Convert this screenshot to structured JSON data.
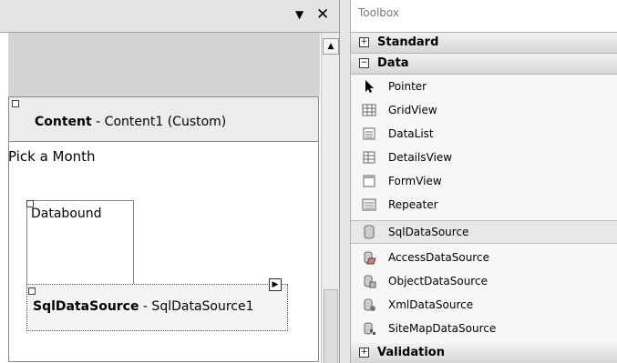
{
  "designer": {
    "content_title_bold": "Content",
    "content_title_rest": " - Content1 (Custom)",
    "pick_month_text": "Pick a Month",
    "databound_label": "Databound",
    "sql_title_bold": "SqlDataSource",
    "sql_title_rest": " - SqlDataSource1"
  },
  "toolbox": {
    "title": "Toolbox",
    "groups": {
      "standard": "Standard",
      "data": "Data",
      "validation": "Validation"
    },
    "tools": [
      {
        "label": "Pointer",
        "icon": "pointer-icon"
      },
      {
        "label": "GridView",
        "icon": "gridview-icon"
      },
      {
        "label": "DataList",
        "icon": "datalist-icon"
      },
      {
        "label": "DetailsView",
        "icon": "detailsview-icon"
      },
      {
        "label": "FormView",
        "icon": "formview-icon"
      },
      {
        "label": "Repeater",
        "icon": "repeater-icon"
      },
      {
        "label": "SqlDataSource",
        "icon": "sqldatasource-icon"
      },
      {
        "label": "AccessDataSource",
        "icon": "accessdatasource-icon"
      },
      {
        "label": "ObjectDataSource",
        "icon": "objectdatasource-icon"
      },
      {
        "label": "XmlDataSource",
        "icon": "xmldatasource-icon"
      },
      {
        "label": "SiteMapDataSource",
        "icon": "sitemapdatasource-icon"
      }
    ]
  },
  "colors": {
    "selected_tool_bg": "#e8e8e8",
    "group_header": "#d6d6d6"
  }
}
